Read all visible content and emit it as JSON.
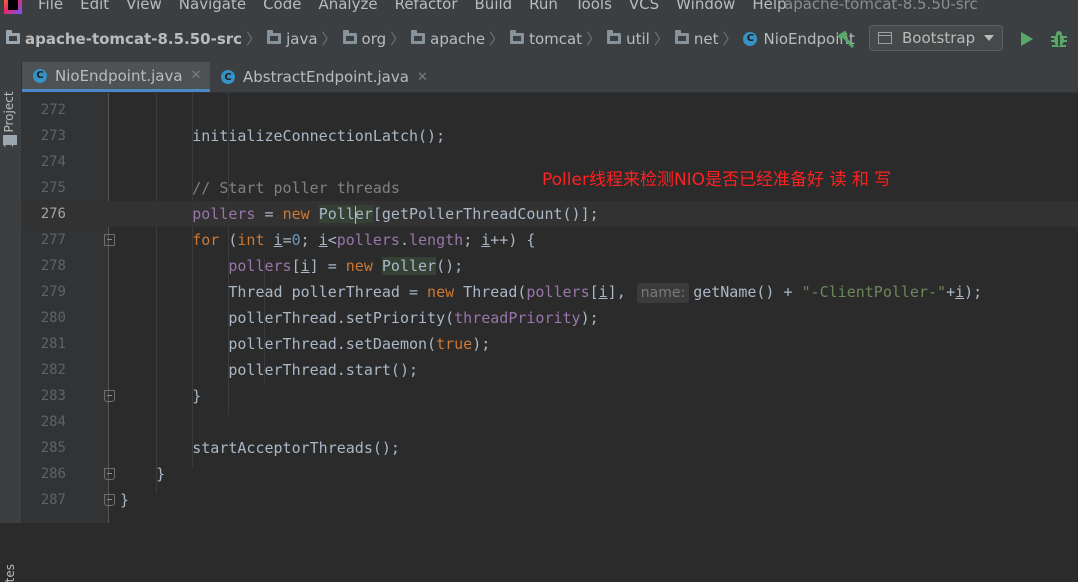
{
  "menubar": {
    "items": [
      "File",
      "Edit",
      "View",
      "Navigate",
      "Code",
      "Analyze",
      "Refactor",
      "Build",
      "Run",
      "Tools",
      "VCS",
      "Window",
      "Help"
    ],
    "window_title": "apache-tomcat-8.5.50-src"
  },
  "navbar": {
    "breadcrumbs": [
      {
        "label": "apache-tomcat-8.5.50-src",
        "icon": "project-folder-icon"
      },
      {
        "label": "java",
        "icon": "folder-icon"
      },
      {
        "label": "org",
        "icon": "folder-icon"
      },
      {
        "label": "apache",
        "icon": "folder-icon"
      },
      {
        "label": "tomcat",
        "icon": "folder-icon"
      },
      {
        "label": "util",
        "icon": "folder-icon"
      },
      {
        "label": "net",
        "icon": "folder-icon"
      },
      {
        "label": "NioEndpoint",
        "icon": "class-icon"
      }
    ],
    "run_config": "Bootstrap"
  },
  "left_strip": {
    "project_tab": "1: Project",
    "bottom_tab": "tes"
  },
  "tabs": [
    {
      "label": "NioEndpoint.java",
      "active": true
    },
    {
      "label": "AbstractEndpoint.java",
      "active": false
    }
  ],
  "editor": {
    "current_line": 276,
    "annotation": "Poller线程来检测NIO是否已经准备好 读 和 写",
    "param_hint": "name:",
    "line_numbers": [
      "272",
      "273",
      "274",
      "275",
      "276",
      "277",
      "278",
      "279",
      "280",
      "281",
      "282",
      "283",
      "284",
      "285",
      "286",
      "287"
    ],
    "lines": [
      "",
      "        initializeConnectionLatch();",
      "",
      "        // Start poller threads",
      "        pollers = new Poller[getPollerThreadCount()];",
      "        for (int i=0; i<pollers.length; i++) {",
      "            pollers[i] = new Poller();",
      "            Thread pollerThread = new Thread(pollers[i], name: getName() + \"-ClientPoller-\"+i);",
      "            pollerThread.setPriority(threadPriority);",
      "            pollerThread.setDaemon(true);",
      "            pollerThread.start();",
      "        }",
      "",
      "        startAcceptorThreads();",
      "    }",
      "}"
    ]
  },
  "colors": {
    "keyword": "#cc7832",
    "comment": "#808080",
    "field": "#9876aa",
    "number": "#6897bb",
    "string": "#6a8759",
    "annotation": "#ff2020",
    "active_tab_underline": "#4a88c7"
  }
}
